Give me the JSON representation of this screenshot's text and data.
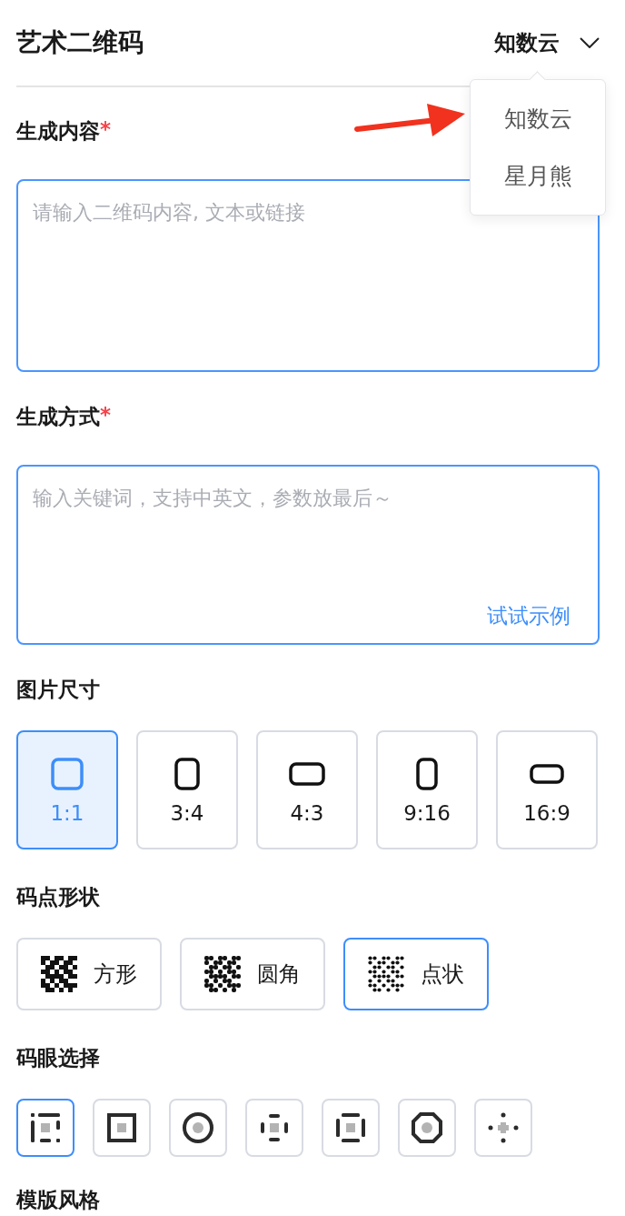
{
  "header": {
    "title": "艺术二维码",
    "provider": "知数云"
  },
  "provider_menu": {
    "options": [
      "知数云",
      "星月熊"
    ]
  },
  "content": {
    "label": "生成内容",
    "required_mark": "*",
    "placeholder": "请输入二维码内容, 文本或链接"
  },
  "method": {
    "label": "生成方式",
    "required_mark": "*",
    "placeholder": "输入关键词，支持中英文，参数放最后～",
    "example_link": "试试示例"
  },
  "size": {
    "label": "图片尺寸",
    "options": [
      {
        "label": "1:1",
        "selected": true
      },
      {
        "label": "3:4",
        "selected": false
      },
      {
        "label": "4:3",
        "selected": false
      },
      {
        "label": "9:16",
        "selected": false
      },
      {
        "label": "16:9",
        "selected": false
      }
    ]
  },
  "dot_shape": {
    "label": "码点形状",
    "options": [
      {
        "label": "方形",
        "selected": false
      },
      {
        "label": "圆角",
        "selected": false
      },
      {
        "label": "点状",
        "selected": true
      }
    ]
  },
  "eye": {
    "label": "码眼选择",
    "options": [
      {
        "selected": true
      },
      {
        "selected": false
      },
      {
        "selected": false
      },
      {
        "selected": false
      },
      {
        "selected": false
      },
      {
        "selected": false
      },
      {
        "selected": false
      }
    ]
  },
  "template_style": {
    "label": "模版风格"
  }
}
